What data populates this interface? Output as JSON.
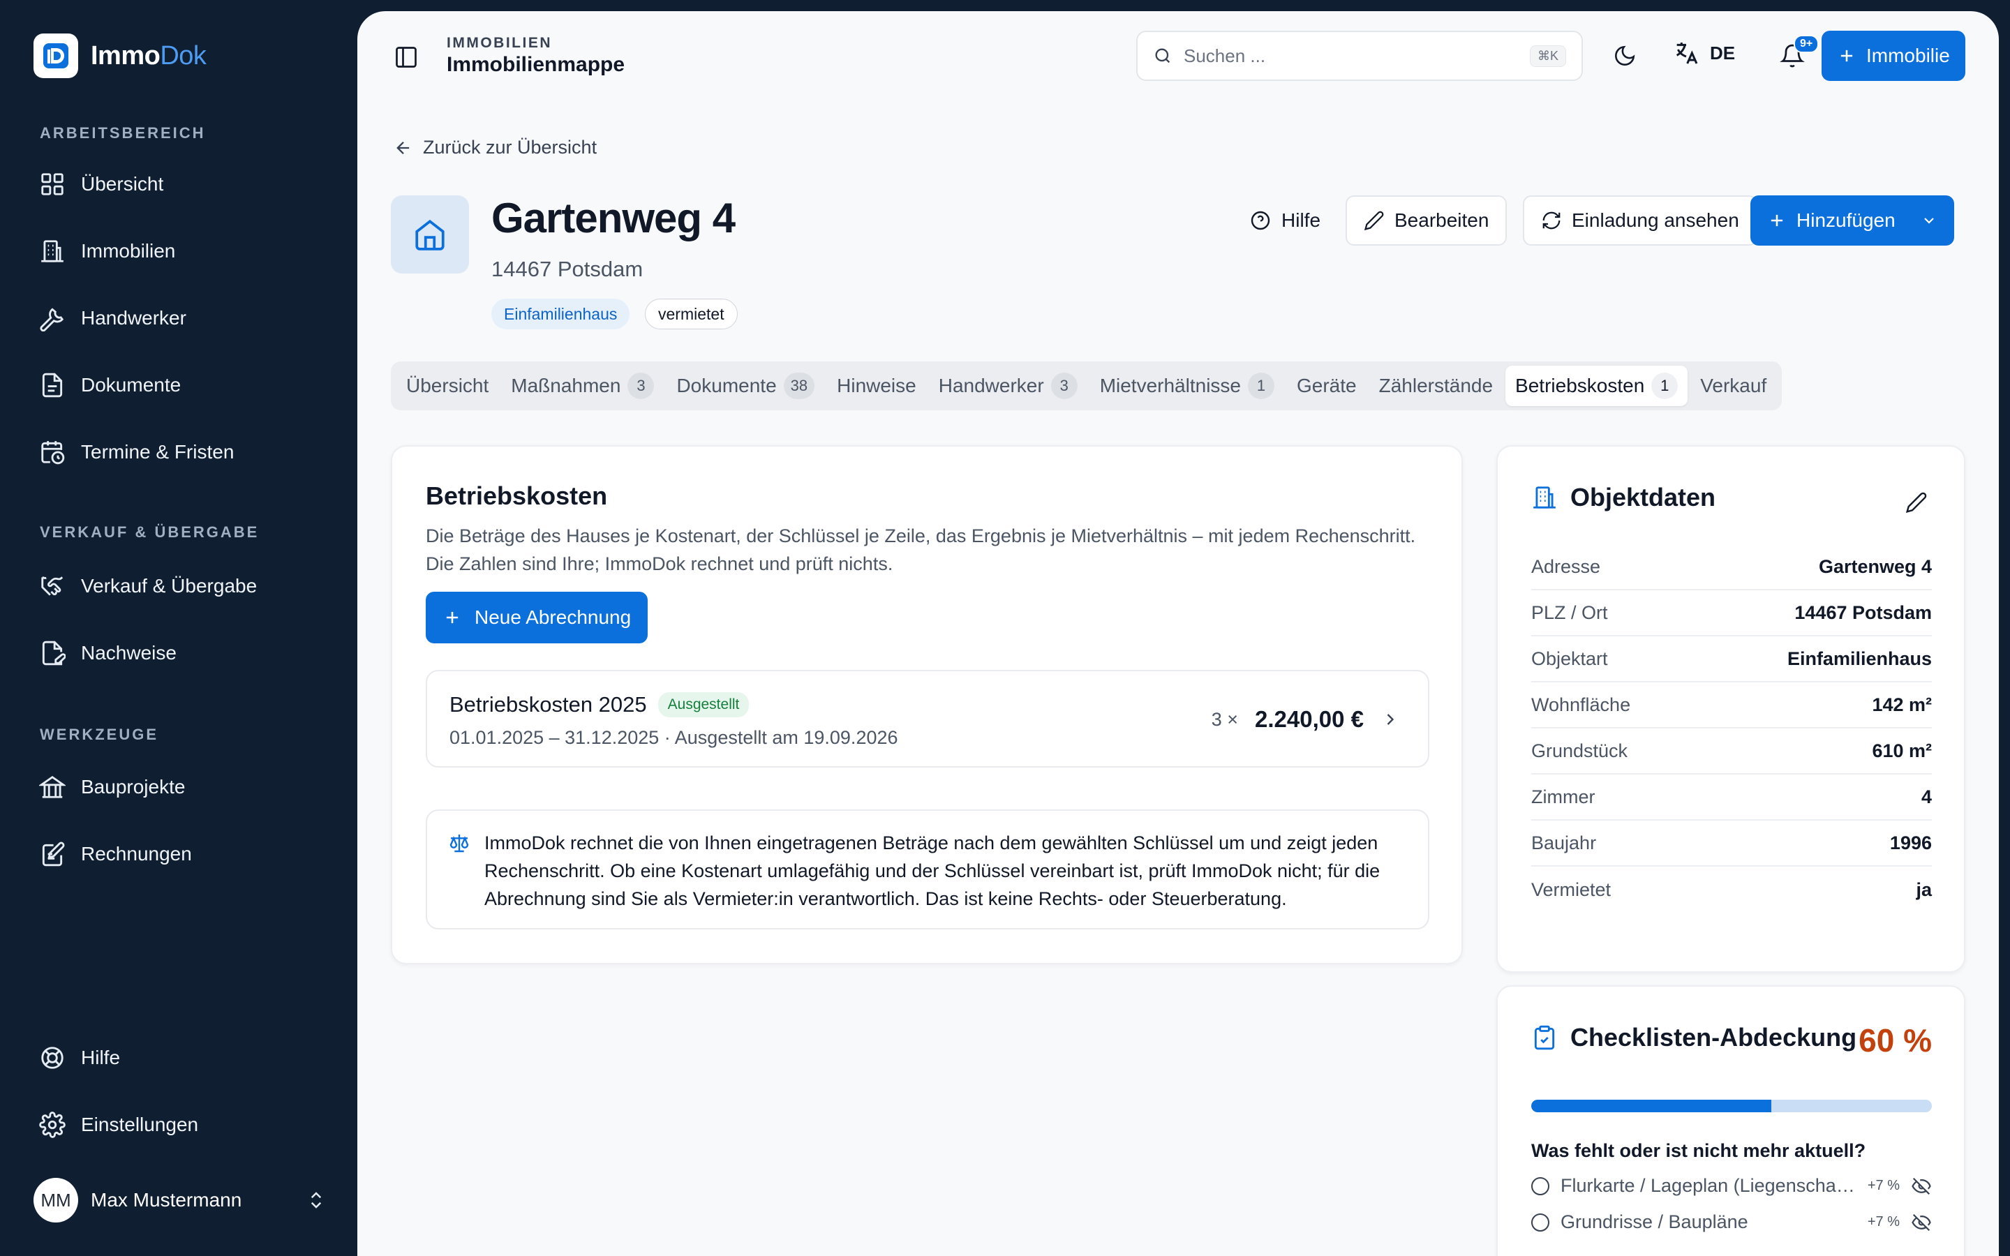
{
  "app": {
    "name_main": "Immo",
    "name_accent": "Dok"
  },
  "sidebar": {
    "sections": [
      {
        "label": "ARBEITSBEREICH"
      },
      {
        "label": "VERKAUF & ÜBERGABE"
      },
      {
        "label": "WERKZEUGE"
      }
    ],
    "items": [
      {
        "label": "Übersicht",
        "icon": "grid-icon"
      },
      {
        "label": "Immobilien",
        "icon": "building-icon"
      },
      {
        "label": "Handwerker",
        "icon": "wrench-icon"
      },
      {
        "label": "Dokumente",
        "icon": "document-icon"
      },
      {
        "label": "Termine & Fristen",
        "icon": "calendar-clock-icon"
      },
      {
        "label": "Verkauf & Übergabe",
        "icon": "handshake-icon"
      },
      {
        "label": "Nachweise",
        "icon": "file-signature-icon"
      },
      {
        "label": "Bauprojekte",
        "icon": "landmark-icon"
      },
      {
        "label": "Rechnungen",
        "icon": "receipt-icon"
      }
    ],
    "footer": [
      {
        "label": "Hilfe",
        "icon": "lifebuoy-icon"
      },
      {
        "label": "Einstellungen",
        "icon": "gear-icon"
      }
    ],
    "user": {
      "initials": "MM",
      "name": "Max Mustermann"
    }
  },
  "topbar": {
    "crumb_small": "IMMOBILIEN",
    "crumb_title": "Immobilienmappe",
    "search_placeholder": "Suchen ...",
    "search_shortcut": "⌘K",
    "language": "DE",
    "notification_badge": "9+",
    "add_label": "Immobilie"
  },
  "page": {
    "back_label": "Zurück zur Übersicht",
    "title": "Gartenweg 4",
    "subtitle": "14467 Potsdam",
    "tags": [
      "Einfamilienhaus",
      "vermietet"
    ],
    "actions": {
      "help": "Hilfe",
      "edit": "Bearbeiten",
      "invite": "Einladung ansehen",
      "add": "Hinzufügen"
    }
  },
  "tabs": [
    {
      "label": "Übersicht",
      "count": ""
    },
    {
      "label": "Maßnahmen",
      "count": "3"
    },
    {
      "label": "Dokumente",
      "count": "38"
    },
    {
      "label": "Hinweise",
      "count": ""
    },
    {
      "label": "Handwerker",
      "count": "3"
    },
    {
      "label": "Mietverhältnisse",
      "count": "1"
    },
    {
      "label": "Geräte",
      "count": ""
    },
    {
      "label": "Zählerstände",
      "count": ""
    },
    {
      "label": "Betriebskosten",
      "count": "1",
      "active": true
    },
    {
      "label": "Verkauf",
      "count": ""
    }
  ],
  "betriebskosten": {
    "heading": "Betriebskosten",
    "description": "Die Beträge des Hauses je Kostenart, der Schlüssel je Zeile, das Ergebnis je Mietverhältnis – mit jedem Rechenschritt. Die Zahlen sind Ihre; ImmoDok rechnet und prüft nichts.",
    "new_button": "Neue Abrechnung",
    "entry": {
      "title": "Betriebskosten 2025",
      "status": "Ausgestellt",
      "period": "01.01.2025 – 31.12.2025 · Ausgestellt am 19.09.2026",
      "multiplier": "3 ×",
      "amount": "2.240,00 €"
    },
    "note": "ImmoDok rechnet die von Ihnen eingetragenen Beträge nach dem gewählten Schlüssel um und zeigt jeden Rechenschritt. Ob eine Kostenart umlagefähig und der Schlüssel vereinbart ist, prüft ImmoDok nicht; für die Abrechnung sind Sie als Vermieter:in verantwortlich. Das ist keine Rechts- oder Steuerberatung."
  },
  "objektdaten": {
    "heading": "Objektdaten",
    "rows": [
      {
        "key": "Adresse",
        "value": "Gartenweg 4"
      },
      {
        "key": "PLZ / Ort",
        "value": "14467 Potsdam"
      },
      {
        "key": "Objektart",
        "value": "Einfamilienhaus"
      },
      {
        "key": "Wohnfläche",
        "value": "142 m²"
      },
      {
        "key": "Grundstück",
        "value": "610 m²"
      },
      {
        "key": "Zimmer",
        "value": "4"
      },
      {
        "key": "Baujahr",
        "value": "1996"
      },
      {
        "key": "Vermietet",
        "value": "ja"
      }
    ]
  },
  "checkliste": {
    "heading": "Checklisten-Abdeckung",
    "percent_label": "60 %",
    "progress": 0.6,
    "missing_heading": "Was fehlt oder ist nicht mehr aktuell?",
    "items": [
      {
        "label": "Flurkarte / Lageplan (Liegenschaftskarte)",
        "plus": "+7 %"
      },
      {
        "label": "Grundrisse / Baupläne",
        "plus": "+7 %"
      }
    ]
  },
  "colors": {
    "accent": "#0b6fdc",
    "sidebar": "#0f1e30",
    "warning": "#c2410c",
    "success": "#15803d"
  }
}
